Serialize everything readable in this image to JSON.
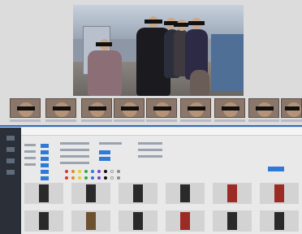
{
  "screen": {
    "title": "",
    "video": {
      "people_count": 6
    },
    "thumbnails": {
      "count": 9
    },
    "search_panel": {
      "result_columns": 6,
      "result_rows": 2
    }
  },
  "colors": {
    "accent_blue": "#2f6cc2",
    "sidebar_bg": "#2a2f38"
  },
  "icons": [
    "menu-icon"
  ]
}
